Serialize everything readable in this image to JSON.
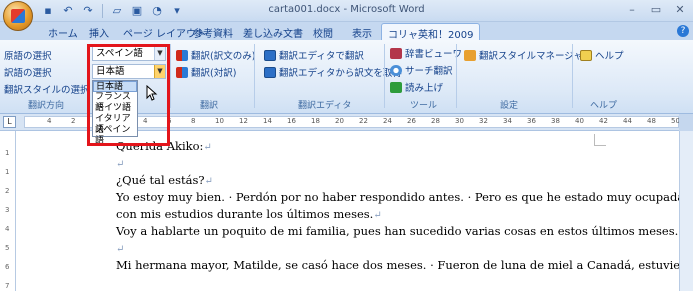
{
  "window": {
    "title": "carta001.docx - Microsoft Word",
    "controls": [
      "–",
      "▭",
      "✕"
    ]
  },
  "quick_access": [
    "save",
    "undo",
    "redo",
    "open",
    "print-preview",
    "next"
  ],
  "tabs": [
    "ホーム",
    "挿入",
    "ページ レイアウト",
    "参考資料",
    "差し込み文書",
    "校閲",
    "表示",
    "コリャ英和！2009"
  ],
  "active_tab": "コリャ英和！2009",
  "ribbon": {
    "lang_group": {
      "source_label": "原語の選択",
      "target_label": "訳語の選択",
      "style_label": "翻訳スタイルの選択",
      "source_value": "スペイン語",
      "target_value": "日本語",
      "group_label": "翻訳方向"
    },
    "translate_group": {
      "btn_full": "翻訳(訳文のみ)",
      "btn_parallel": "翻訳(対訳)",
      "group_label": "翻訳"
    },
    "editor_group": {
      "btn_open_editor": "翻訳エディタで翻訳",
      "btn_get_from_editor": "翻訳エディタから訳文を取得",
      "group_label": "翻訳エディタ"
    },
    "tools_group": {
      "btn_dict_viewer": "辞書ビューワ",
      "btn_search_translate": "サーチ翻訳",
      "btn_read_aloud": "読み上げ",
      "group_label": "ツール"
    },
    "settings_group": {
      "btn_style_manager": "翻訳スタイルマネージャ",
      "group_label": "設定"
    },
    "help_group": {
      "btn_help": "ヘルプ",
      "group_label": "ヘルプ"
    }
  },
  "dropdown": {
    "items": [
      "日本語",
      "フランス語",
      "ドイツ語",
      "イタリア語",
      "スペイン語"
    ],
    "selected_index": 0
  },
  "ruler": {
    "numbers": [
      "4",
      "2",
      "",
      "2",
      "4",
      "6",
      "8",
      "10",
      "12",
      "14",
      "16",
      "18",
      "20",
      "22",
      "24",
      "26",
      "28",
      "30",
      "32",
      "34",
      "36",
      "38",
      "40",
      "42",
      "44",
      "48",
      "50"
    ]
  },
  "vruler_numbers": [
    "1",
    "1",
    "2",
    "3",
    "4",
    "5",
    "6",
    "7"
  ],
  "document": {
    "lines": [
      "Querida Akiko:",
      "",
      "¿Qué tal estás?",
      "Yo estoy muy bien. · Perdón por no haber respondido antes. · Pero es que he estado muy ocupada",
      "con mis estudios durante los últimos meses.",
      "Voy a hablarte un poquito de mi familia, pues han sucedido varias cosas en estos últimos meses.",
      "",
      "Mi hermana mayor, Matilde, se casó hace dos meses. · Fueron de luna de miel a Canadá, estuvieron"
    ],
    "paragraph_mark": "↵"
  }
}
